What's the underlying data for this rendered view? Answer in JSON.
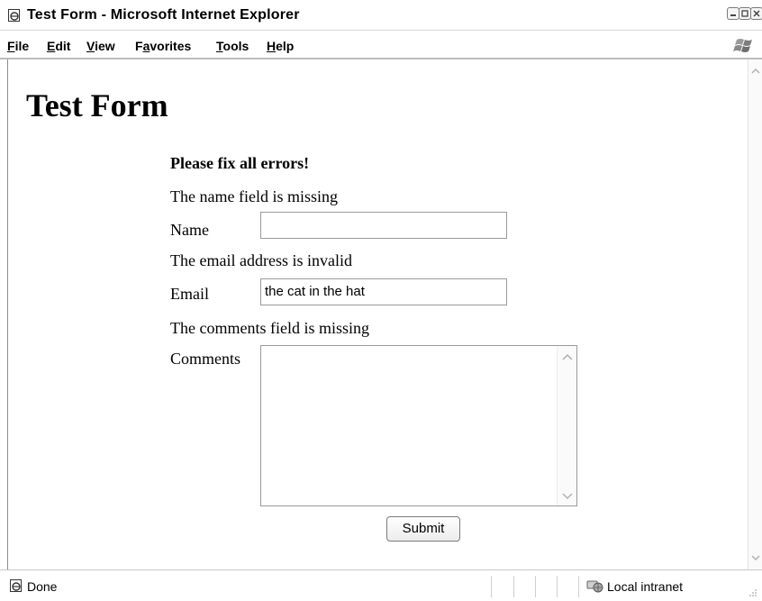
{
  "window": {
    "title": "Test Form - Microsoft Internet Explorer",
    "icon": "ie-page-icon",
    "controls": [
      "minimize-icon",
      "maximize-icon",
      "close-icon"
    ]
  },
  "menubar": {
    "items": [
      {
        "label": "File",
        "accel": "F",
        "rest": "ile"
      },
      {
        "label": "Edit",
        "accel": "E",
        "rest": "dit"
      },
      {
        "label": "View",
        "accel": "V",
        "rest": "iew"
      },
      {
        "label": "Favorites",
        "accel": "a",
        "pre": "F",
        "rest": "vorites"
      },
      {
        "label": "Tools",
        "accel": "T",
        "rest": "ools"
      },
      {
        "label": "Help",
        "accel": "H",
        "rest": "elp"
      }
    ],
    "logo": "windows-flag-icon"
  },
  "page": {
    "heading": "Test Form",
    "error_summary": "Please fix all errors!",
    "name_error": "The name field is missing",
    "name_label": "Name",
    "name_value": "",
    "email_error": "The email address is invalid",
    "email_label": "Email",
    "email_value": "the cat in the hat",
    "comments_error": "The comments field is missing",
    "comments_label": "Comments",
    "comments_value": "",
    "submit_label": "Submit"
  },
  "statusbar": {
    "status": "Done",
    "zone": "Local intranet"
  }
}
